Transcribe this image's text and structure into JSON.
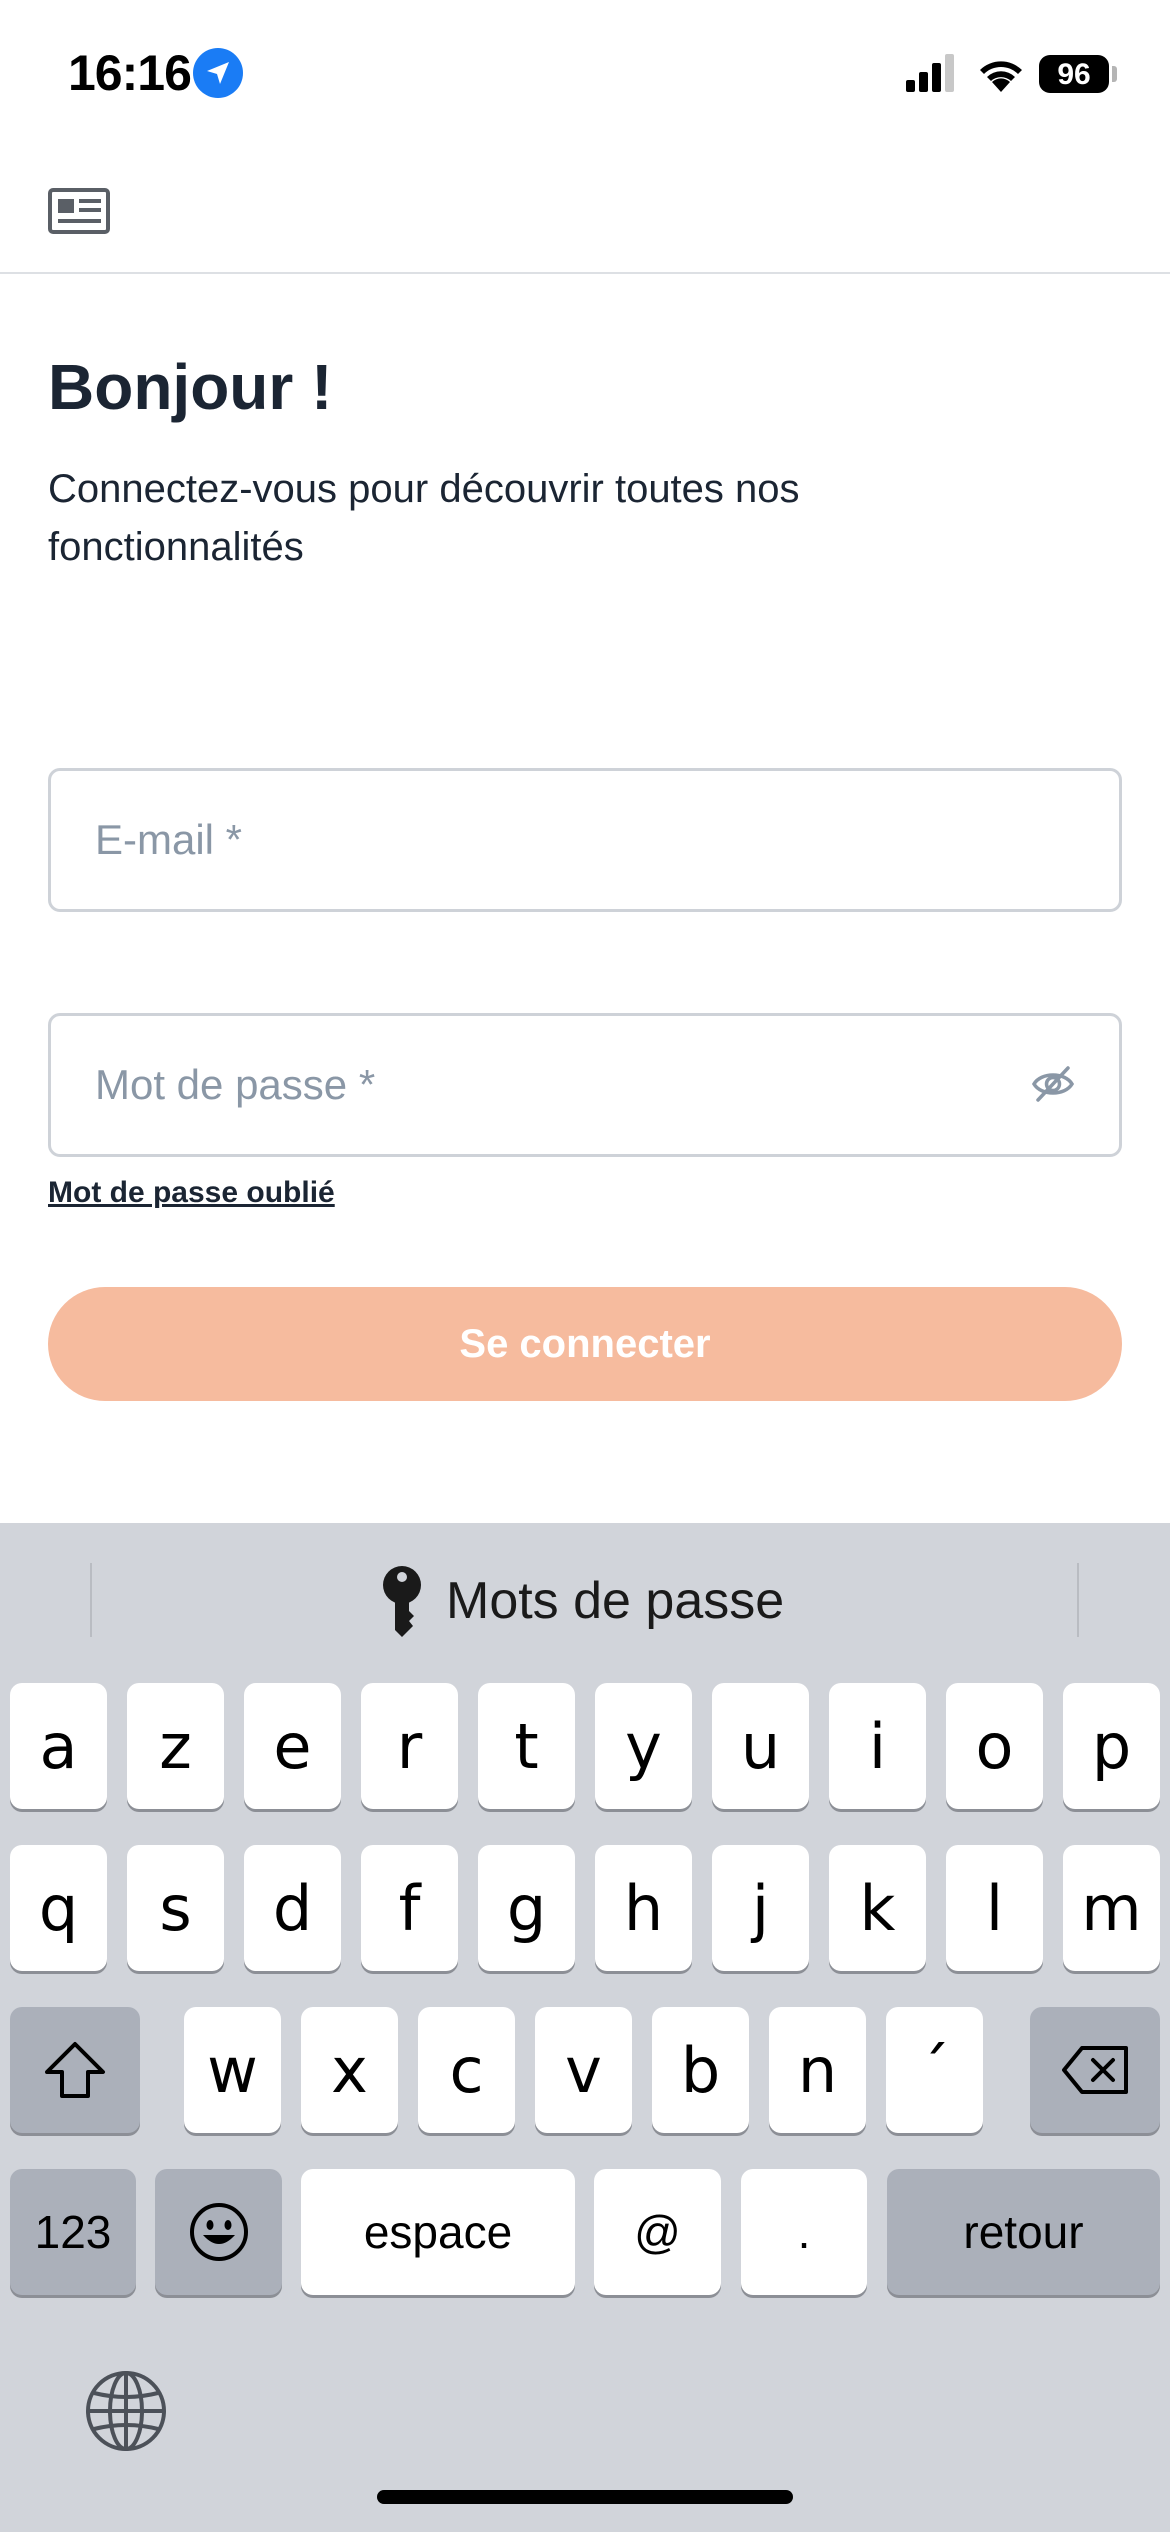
{
  "status_bar": {
    "time": "16:16",
    "battery": "96",
    "location_icon": "location-arrow-icon",
    "signal_icon": "cellular-signal-icon",
    "wifi_icon": "wifi-icon"
  },
  "header": {
    "icon": "newspaper-icon"
  },
  "intro": {
    "title": "Bonjour !",
    "subtitle": "Connectez-vous pour découvrir toutes nos fonctionnalités"
  },
  "form": {
    "email_placeholder": "E-mail *",
    "email_value": "",
    "password_placeholder": "Mot de passe *",
    "password_value": "",
    "forgot_password": "Mot de passe oublié",
    "submit_label": "Se connecter"
  },
  "colors": {
    "button": "#f6bb9e",
    "text": "#1b2533",
    "placeholder": "#8a97a6",
    "keyboard_bg": "#d1d4da"
  },
  "keyboard": {
    "suggestion": "Mots de passe",
    "row1": [
      "a",
      "z",
      "e",
      "r",
      "t",
      "y",
      "u",
      "i",
      "o",
      "p"
    ],
    "row2": [
      "q",
      "s",
      "d",
      "f",
      "g",
      "h",
      "j",
      "k",
      "l",
      "m"
    ],
    "row3": [
      "w",
      "x",
      "c",
      "v",
      "b",
      "n",
      "´"
    ],
    "numbers_key": "123",
    "space_key": "espace",
    "at_key": "@",
    "dot_key": ".",
    "return_key": "retour"
  }
}
